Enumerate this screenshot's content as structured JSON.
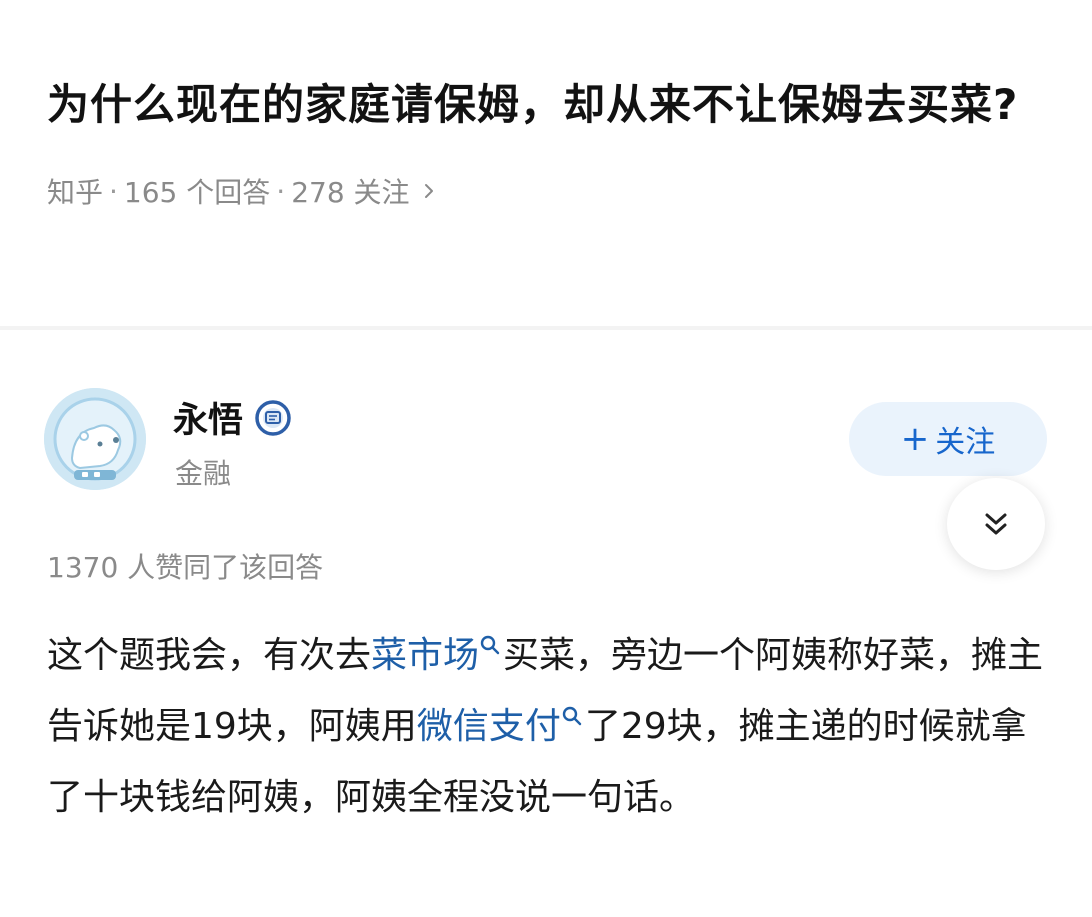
{
  "question": {
    "title": "为什么现在的家庭请保姆，却从来不让保姆去买菜?",
    "source": "知乎",
    "separator": "·",
    "answers_count": "165 个回答",
    "followers_count": "278 关注"
  },
  "answer": {
    "author_name": "永悟",
    "author_tag": "金融",
    "follow_label": "关注",
    "follow_plus": "+",
    "vote_text": "1370 人赞同了该回答",
    "content": {
      "seg1": "这个题我会，有次去",
      "link1": "菜市场",
      "seg2": "买菜，旁边一个阿姨称好菜，摊主告诉她是19块，阿姨用",
      "link2": "微信支付",
      "seg3": "了29块，摊主递的时候就拿了十块钱给阿姨，阿姨全程没说一句话。"
    }
  },
  "icons": {
    "verified": "verified-badge-icon",
    "chevron": "chevron-right-icon",
    "collapse": "double-chevron-down-icon",
    "search": "search-icon",
    "avatar": "polar-bear-astronaut-avatar"
  },
  "colors": {
    "link": "#1e5fa8",
    "follow_text": "#1766cc",
    "follow_bg": "#eaf3fc",
    "meta_gray": "#8a8a8a"
  }
}
